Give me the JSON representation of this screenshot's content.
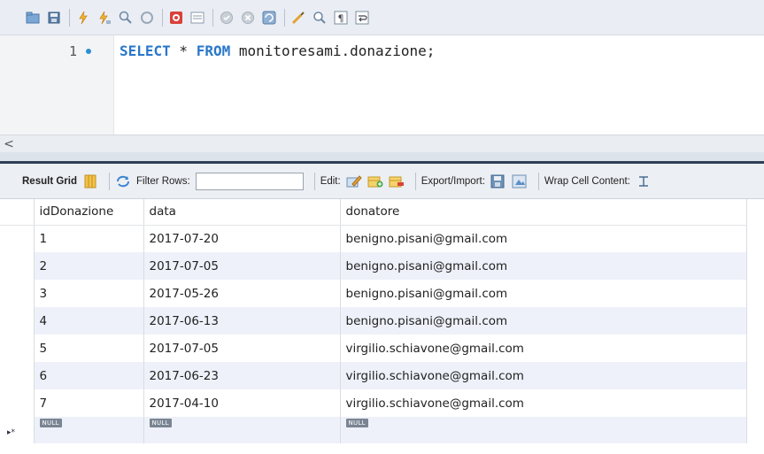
{
  "editor": {
    "toolbar_icons": [
      "open-folder-icon",
      "save-icon",
      "execute-icon",
      "execute-current-icon",
      "explain-icon",
      "stop-icon",
      "toggle-error-icon",
      "toggle-output-icon",
      "commit-icon",
      "rollback-icon",
      "autocommit-icon",
      "beautify-icon",
      "find-icon",
      "invisible-chars-icon",
      "wrap-icon"
    ],
    "line_number": "1",
    "sql": {
      "kw1": "SELECT",
      "star": " * ",
      "kw2": "FROM",
      "rest": " monitoresami.donazione;"
    }
  },
  "scrollbar": {
    "left_arrow": "<"
  },
  "result_toolbar": {
    "result_grid_label": "Result Grid",
    "filter_rows_label": "Filter Rows:",
    "filter_value": "",
    "edit_label": "Edit:",
    "export_import_label": "Export/Import:",
    "wrap_label": "Wrap Cell Content:"
  },
  "grid": {
    "columns": [
      "idDonazione",
      "data",
      "donatore"
    ],
    "rows": [
      [
        "1",
        "2017-07-20",
        "benigno.pisani@gmail.com"
      ],
      [
        "2",
        "2017-07-05",
        "benigno.pisani@gmail.com"
      ],
      [
        "3",
        "2017-05-26",
        "benigno.pisani@gmail.com"
      ],
      [
        "4",
        "2017-06-13",
        "benigno.pisani@gmail.com"
      ],
      [
        "5",
        "2017-07-05",
        "virgilio.schiavone@gmail.com"
      ],
      [
        "6",
        "2017-06-23",
        "virgilio.schiavone@gmail.com"
      ],
      [
        "7",
        "2017-04-10",
        "virgilio.schiavone@gmail.com"
      ]
    ],
    "null_label": "NULL",
    "new_row_marker": "▸*"
  },
  "colors": {
    "keyword": "#2a77c9",
    "line_dot": "#2d8fd6",
    "alt_row": "#eef1f9",
    "splitter": "#2d3f57"
  }
}
